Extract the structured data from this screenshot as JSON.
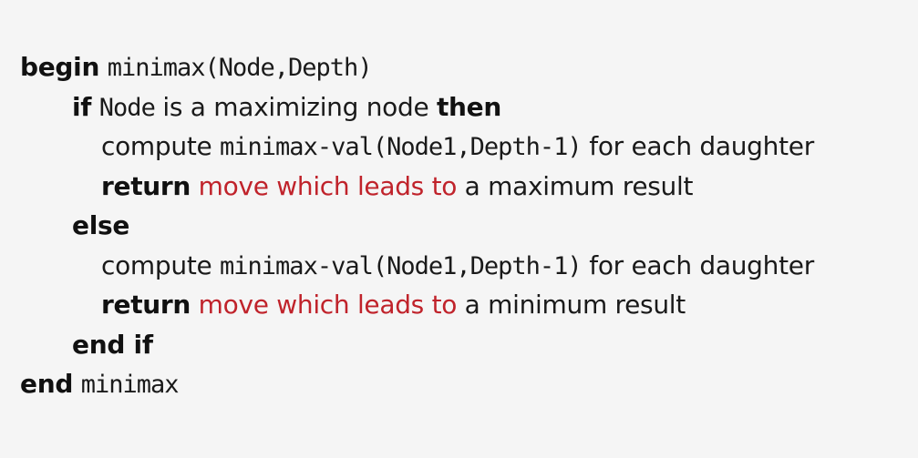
{
  "lines": [
    {
      "parts": [
        {
          "text": "begin",
          "style": "kw"
        },
        {
          "text": " ",
          "style": "plain"
        },
        {
          "text": "minimax(Node,Depth)",
          "style": "mono"
        }
      ]
    },
    {
      "parts": [
        {
          "text": "if",
          "style": "kw"
        },
        {
          "text": " ",
          "style": "plain"
        },
        {
          "text": "Node",
          "style": "mono"
        },
        {
          "text": " is a maximizing node ",
          "style": "plain"
        },
        {
          "text": "then",
          "style": "kw"
        }
      ]
    },
    {
      "parts": [
        {
          "text": "compute ",
          "style": "plain"
        },
        {
          "text": "minimax-val(Node1,Depth-1)",
          "style": "mono"
        },
        {
          "text": " for each daughter",
          "style": "plain"
        }
      ]
    },
    {
      "parts": [
        {
          "text": "return",
          "style": "kw"
        },
        {
          "text": " ",
          "style": "plain"
        },
        {
          "text": "move which leads to",
          "style": "red"
        },
        {
          "text": " a maximum result",
          "style": "plain"
        }
      ]
    },
    {
      "parts": [
        {
          "text": "else",
          "style": "kw"
        }
      ]
    },
    {
      "parts": [
        {
          "text": "compute ",
          "style": "plain"
        },
        {
          "text": "minimax-val(Node1,Depth-1)",
          "style": "mono"
        },
        {
          "text": " for each daughter",
          "style": "plain"
        }
      ]
    },
    {
      "parts": [
        {
          "text": "return",
          "style": "kw"
        },
        {
          "text": " ",
          "style": "plain"
        },
        {
          "text": "move which leads to",
          "style": "red"
        },
        {
          "text": " a minimum result",
          "style": "plain"
        }
      ]
    },
    {
      "parts": [
        {
          "text": "end if",
          "style": "kw"
        }
      ]
    },
    {
      "parts": [
        {
          "text": "end",
          "style": "kw"
        },
        {
          "text": " ",
          "style": "plain"
        },
        {
          "text": "minimax",
          "style": "mono"
        }
      ]
    }
  ],
  "colors": {
    "background": "#f5f5f5",
    "text": "#1a1a1a",
    "highlight": "#c0232b"
  }
}
